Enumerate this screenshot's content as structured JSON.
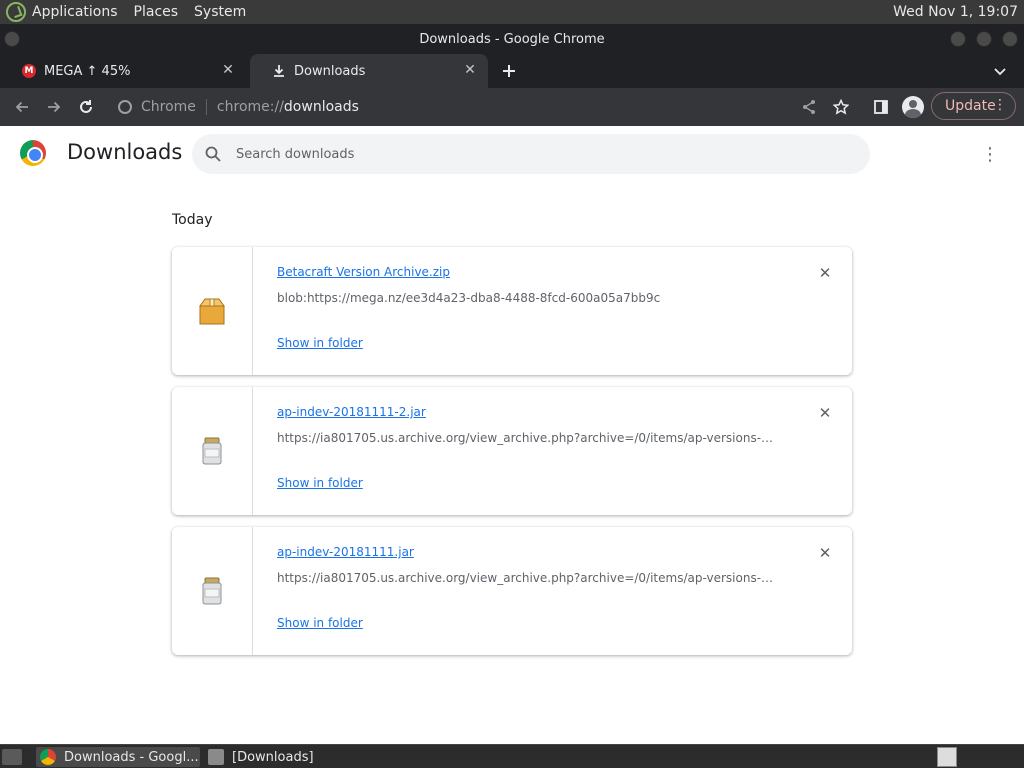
{
  "desktop": {
    "menu": [
      "Applications",
      "Places",
      "System"
    ],
    "clock": "Wed Nov  1, 19:07"
  },
  "window": {
    "title": "Downloads - Google Chrome"
  },
  "tabs": [
    {
      "label": "MEGA ↑ 45%",
      "favicon": "mega-icon",
      "active": false
    },
    {
      "label": "Downloads",
      "favicon": "download-icon",
      "active": true
    }
  ],
  "toolbar": {
    "chip_label": "Chrome",
    "url_scheme": "chrome://",
    "url_host": "downloads",
    "update_label": "Update"
  },
  "page": {
    "title": "Downloads",
    "search_placeholder": "Search downloads",
    "section": "Today"
  },
  "downloads": [
    {
      "name": "Betacraft Version Archive.zip",
      "url": "blob:https://mega.nz/ee3d4a23-dba8-4488-8fcd-600a05a7bb9c",
      "action": "Show in folder",
      "icon": "zip-archive-icon"
    },
    {
      "name": "ap-indev-20181111-2.jar",
      "url": "https://ia801705.us.archive.org/view_archive.php?archive=/0/items/ap-versions-clie...",
      "action": "Show in folder",
      "icon": "jar-icon"
    },
    {
      "name": "ap-indev-20181111.jar",
      "url": "https://ia801705.us.archive.org/view_archive.php?archive=/0/items/ap-versions-clie...",
      "action": "Show in folder",
      "icon": "jar-icon"
    }
  ],
  "taskbar": {
    "items": [
      {
        "label": "Downloads - Googl..."
      },
      {
        "label": "[Downloads]"
      }
    ]
  },
  "colors": {
    "link": "#1a73e8",
    "chrome_dark": "#202124",
    "toolbar": "#35363a",
    "update_accent": "#f2b8b5"
  }
}
